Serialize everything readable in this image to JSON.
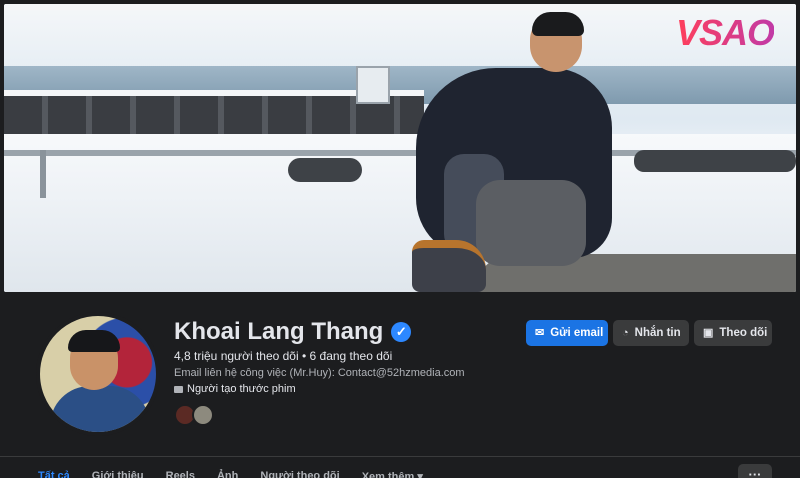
{
  "cover": {
    "logo_text": "VSAO"
  },
  "profile": {
    "name": "Khoai Lang Thang",
    "verified_glyph": "✓",
    "followers_line": "4,8 triệu người theo dõi • 6 đang theo dõi",
    "email_line": "Email liên hệ công việc (Mr.Huy): Contact@52hzmedia.com",
    "category": "Người tạo thước phim"
  },
  "actions": {
    "email_label": "Gửi email",
    "message_label": "Nhắn tin",
    "follow_label": "Theo dõi"
  },
  "tabs": [
    {
      "label": "Tất cả",
      "active": true
    },
    {
      "label": "Giới thiệu"
    },
    {
      "label": "Reels"
    },
    {
      "label": "Ảnh"
    },
    {
      "label": "Người theo dõi"
    },
    {
      "label": "Xem thêm ▾"
    }
  ],
  "more_button": "···",
  "colors": {
    "accent": "#1b74e4",
    "background": "#1c1d1f",
    "button_secondary": "#3a3b3c",
    "logo_gradient_start": "#ff3f5a",
    "logo_gradient_end": "#c13aa6"
  },
  "icons": {
    "verified": "verified-badge-icon",
    "email": "envelope-icon",
    "message": "messenger-icon",
    "follow": "follow-icon",
    "category": "video-camera-icon"
  }
}
